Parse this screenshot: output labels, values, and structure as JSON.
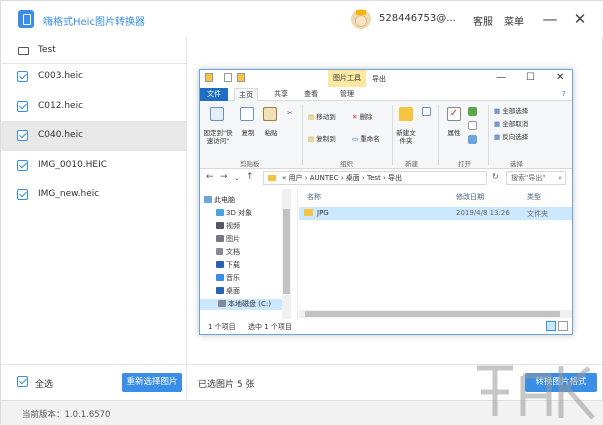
{
  "app": {
    "title": "嗨格式Heic图片转换器",
    "user_id": "528446753@...",
    "service_label": "客服",
    "menu_label": "菜单",
    "minimize_glyph": "—",
    "close_glyph": "✕",
    "accent_color": "#3a8ee6"
  },
  "sidebar": {
    "folder": "Test",
    "files": [
      {
        "name": "C003.heic",
        "checked": true,
        "selected": false
      },
      {
        "name": "C012.heic",
        "checked": true,
        "selected": false
      },
      {
        "name": "C040.heic",
        "checked": true,
        "selected": true
      },
      {
        "name": "IMG_0010.HEIC",
        "checked": true,
        "selected": false
      },
      {
        "name": "IMG_new.heic",
        "checked": true,
        "selected": false
      }
    ]
  },
  "bottom": {
    "select_all_label": "全选",
    "reselect_button": "重新选择图片",
    "selected_count_text": "已选图片 5 张",
    "convert_button": "转换图片格式"
  },
  "status": {
    "version": "当前版本：1.0.1.6570"
  },
  "explorer": {
    "context_tab": "图片工具",
    "window_title": "导出",
    "tabs": [
      "文件",
      "主页",
      "共享",
      "查看",
      "管理"
    ],
    "ribbon": {
      "pin_label": "固定到\"快速访问\"",
      "copy_label": "复制",
      "paste_label": "粘贴",
      "move_to": "移动到",
      "copy_to": "复制到",
      "delete": "删除",
      "rename": "重命名",
      "new_folder": "新建文件夹",
      "properties": "属性",
      "select_all": "全部选择",
      "select_none": "全部取消",
      "invert": "反向选择",
      "groups": [
        "剪贴板",
        "组织",
        "新建",
        "打开",
        "选择"
      ]
    },
    "address": {
      "path": "« 用户 › AUNTEC › 桌面 › Test › 导出",
      "search_placeholder": "搜索\"导出\""
    },
    "nav_items": [
      "此电脑",
      "3D 对象",
      "视频",
      "图片",
      "文档",
      "下载",
      "音乐",
      "桌面",
      "本地磁盘 (C:)"
    ],
    "columns": {
      "name": "名称",
      "date": "修改日期",
      "type": "类型"
    },
    "rows": [
      {
        "name": "JPG",
        "date": "2019/4/8 13:26",
        "type": "文件夹"
      }
    ],
    "status_count": "1 个项目",
    "status_selected": "选中 1 个项目"
  }
}
